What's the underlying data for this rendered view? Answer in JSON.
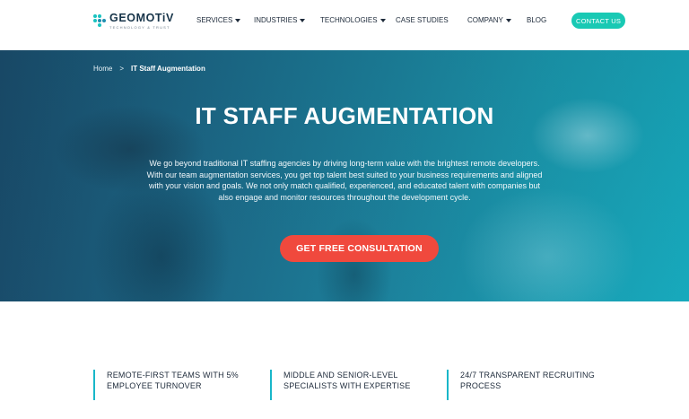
{
  "logo": {
    "name": "GEOMOTiV",
    "tagline": "TECHNOLOGY & TRUST"
  },
  "nav": {
    "items": [
      {
        "label": "SERVICES",
        "has_dropdown": true
      },
      {
        "label": "INDUSTRIES",
        "has_dropdown": true
      },
      {
        "label": "TECHNOLOGIES",
        "has_dropdown": true
      },
      {
        "label": "CASE STUDIES",
        "has_dropdown": false
      },
      {
        "label": "COMPANY",
        "has_dropdown": true
      },
      {
        "label": "BLOG",
        "has_dropdown": false
      }
    ],
    "contact_label": "CONTACT US"
  },
  "hero": {
    "breadcrumb": {
      "home": "Home",
      "separator": ">",
      "current": "IT Staff Augmentation"
    },
    "title": "IT STAFF AUGMENTATION",
    "description": "We go beyond traditional IT staffing agencies by driving long-term value with the brightest remote developers. With our team augmentation services, you get top talent best suited to your business requirements and aligned with your vision and goals. We not only match qualified, experienced, and educated talent with companies but also engage and monitor resources throughout the development cycle.",
    "cta_label": "GET FREE CONSULTATION"
  },
  "features": [
    {
      "text": "REMOTE-FIRST TEAMS WITH 5% EMPLOYEE TURNOVER"
    },
    {
      "text": "MIDDLE AND SENIOR-LEVEL SPECIALISTS WITH EXPERTISE"
    },
    {
      "text": "24/7 TRANSPARENT RECRUITING PROCESS"
    }
  ],
  "colors": {
    "accent_teal": "#19c9b4",
    "cta_red": "#f0493d",
    "feature_border": "#19b7c9",
    "text_dark": "#1d2a3a"
  }
}
